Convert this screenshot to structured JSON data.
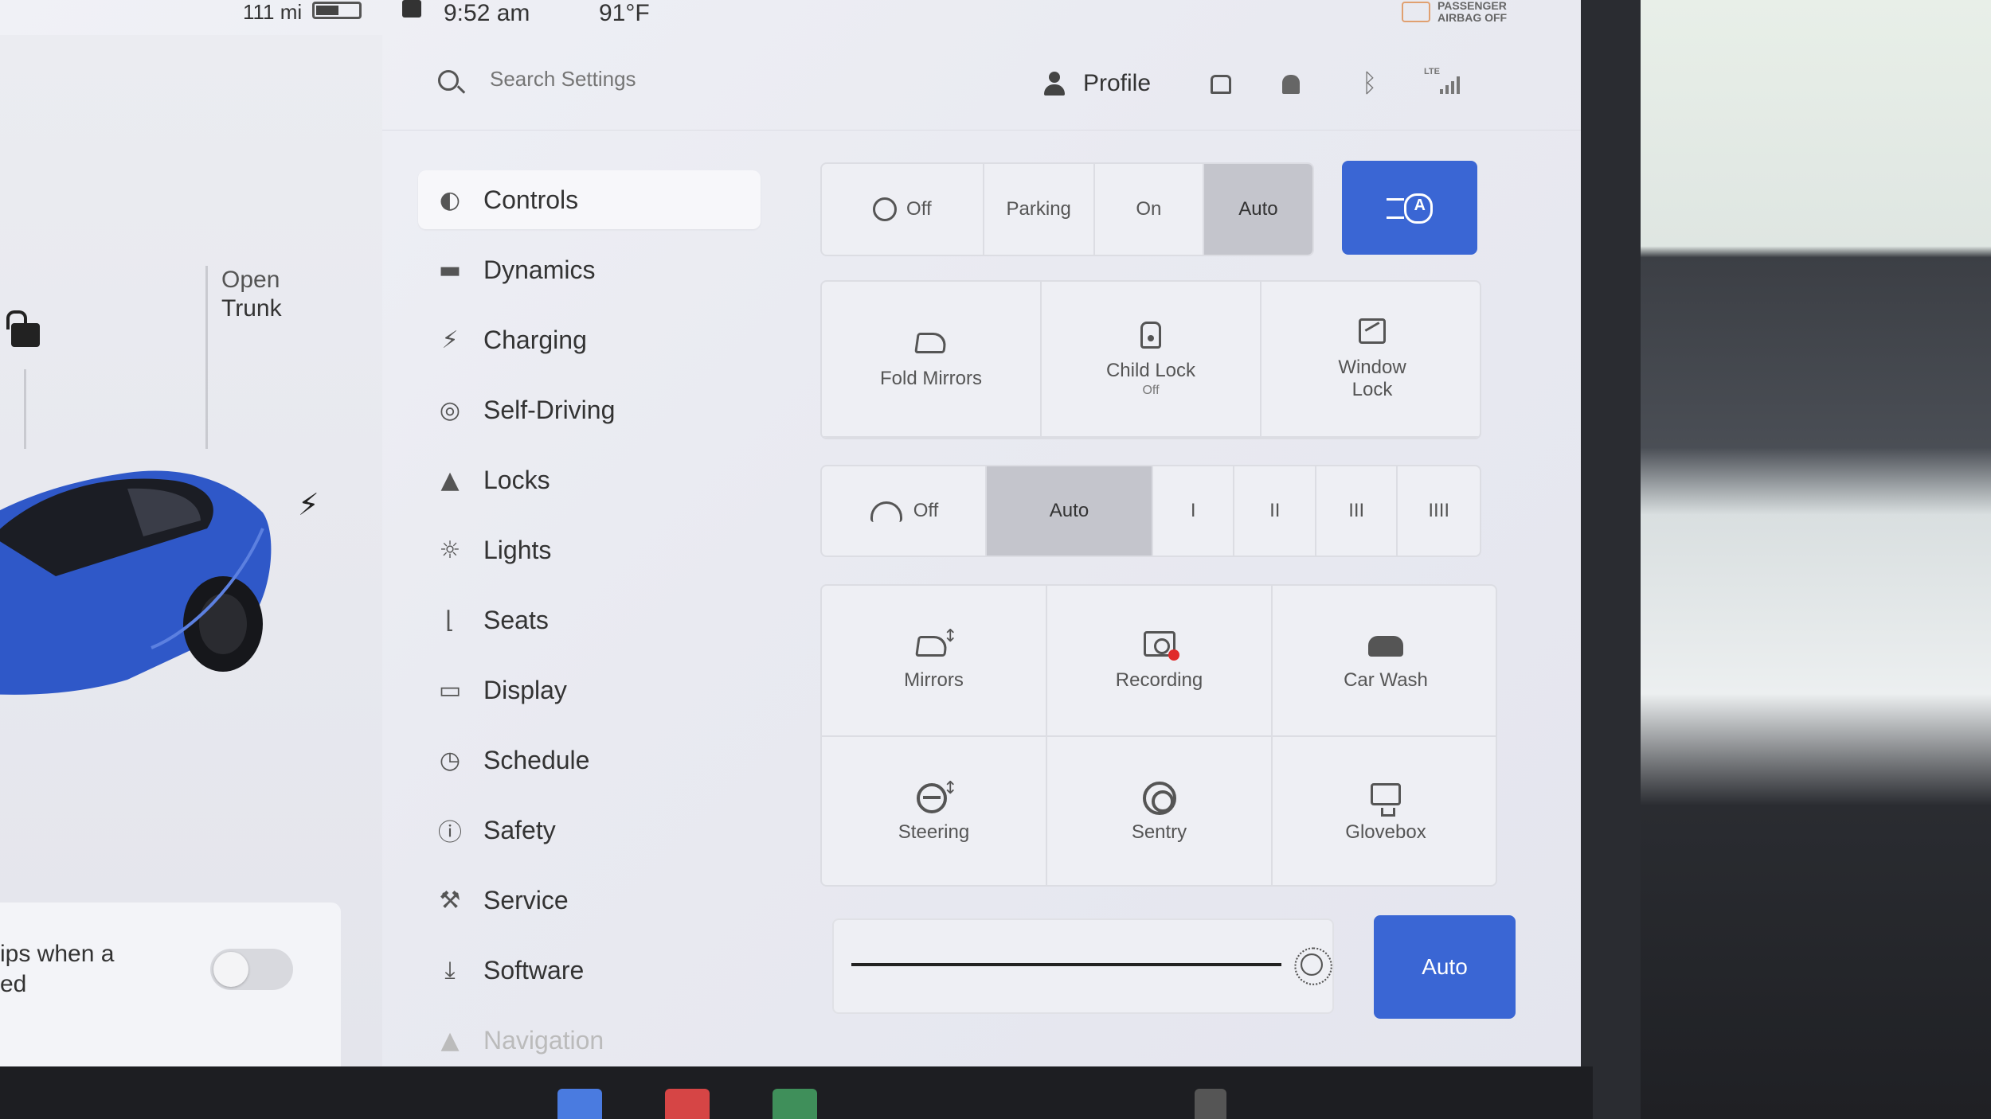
{
  "status": {
    "range": "111 mi",
    "time": "9:52 am",
    "temperature": "91°F",
    "airbag": "PASSENGER AIRBAG OFF"
  },
  "car": {
    "open_trunk_line1": "Open",
    "open_trunk_line2": "Trunk",
    "toggle_text": "ips when a ed",
    "body_color": "#2f58c8"
  },
  "header": {
    "search_placeholder": "Search Settings",
    "profile_label": "Profile",
    "lte_label": "LTE"
  },
  "sidebar": {
    "items": [
      {
        "label": "Controls",
        "icon": "toggle-icon",
        "active": true
      },
      {
        "label": "Dynamics",
        "icon": "car-icon"
      },
      {
        "label": "Charging",
        "icon": "bolt-icon"
      },
      {
        "label": "Self-Driving",
        "icon": "steering-wheel-icon"
      },
      {
        "label": "Locks",
        "icon": "lock-icon"
      },
      {
        "label": "Lights",
        "icon": "light-icon"
      },
      {
        "label": "Seats",
        "icon": "seat-icon"
      },
      {
        "label": "Display",
        "icon": "display-icon"
      },
      {
        "label": "Schedule",
        "icon": "clock-icon"
      },
      {
        "label": "Safety",
        "icon": "alert-icon"
      },
      {
        "label": "Service",
        "icon": "wrench-icon"
      },
      {
        "label": "Software",
        "icon": "download-icon"
      },
      {
        "label": "Navigation",
        "icon": "navigation-icon"
      }
    ]
  },
  "headlights": {
    "options": [
      "Off",
      "Parking",
      "On",
      "Auto"
    ],
    "selected": "Auto"
  },
  "quick_controls": {
    "fold_mirrors": "Fold Mirrors",
    "child_lock": "Child Lock",
    "child_lock_state": "Off",
    "window_lock_line1": "Window",
    "window_lock_line2": "Lock"
  },
  "wipers": {
    "options": [
      "Off",
      "Auto",
      "I",
      "II",
      "III",
      "IIII"
    ],
    "selected": "Auto"
  },
  "tiles": {
    "mirrors": "Mirrors",
    "recording": "Recording",
    "car_wash": "Car Wash",
    "steering": "Steering",
    "sentry": "Sentry",
    "glovebox": "Glovebox"
  },
  "display": {
    "brightness_auto": "Auto"
  },
  "colors": {
    "accent": "#3a66d4",
    "recording_dot": "#e02a2a"
  }
}
